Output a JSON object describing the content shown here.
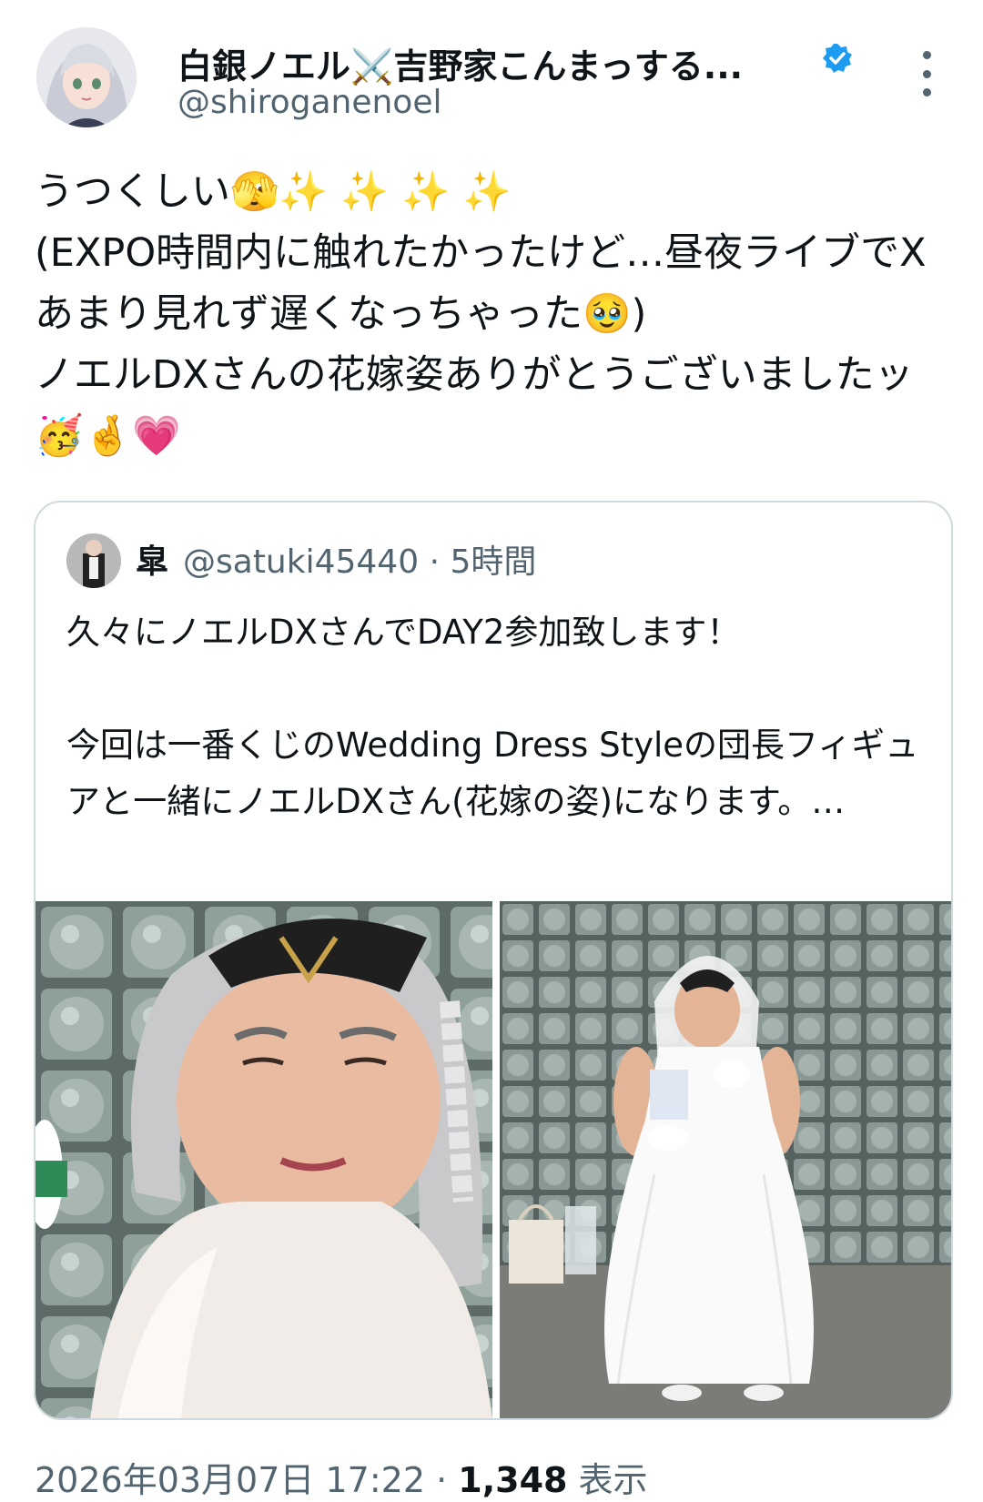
{
  "author": {
    "display_name": "白銀ノエル⚔️吉野家こんまっする...",
    "handle": "@shiroganenoel",
    "verified": true,
    "avatar_icon": "anime-avatar-icon"
  },
  "tweet": {
    "text": "うつくしい🫣✨ ✨ ✨ ✨\n(EXPO時間内に触れたかったけど…昼夜ライブでXあまり見れず遅くなっちゃった🥹)\nノエルDXさんの花嫁姿ありがとうございましたッ🥳🤞💗"
  },
  "quoted_tweet": {
    "display_name": "皐",
    "handle_time": "@satuki45440 · 5時間",
    "text": "久々にノエルDXさんでDAY2参加致します！\n\n今回は一番くじのWedding Dress Styleの団長フィギュアと一緒にノエルDXさん(花嫁の姿)になります。…",
    "images": [
      "cosplay-bride-closeup-photo",
      "cosplay-bride-fullbody-photo"
    ]
  },
  "footer": {
    "timestamp": "2026年03月07日 17:22 · ",
    "views_count": "1,348",
    "views_label": " 表示"
  },
  "colors": {
    "text": "#0f1419",
    "secondary": "#536471",
    "border": "#cfd9de",
    "verified": "#1d9bf0"
  }
}
